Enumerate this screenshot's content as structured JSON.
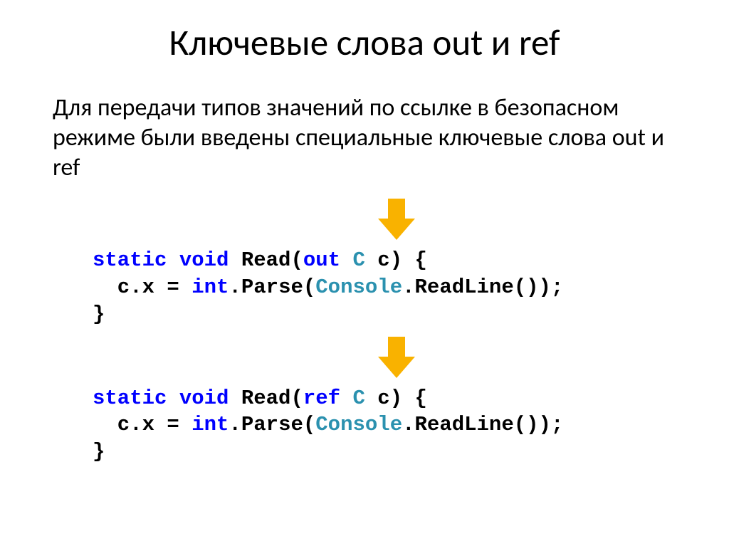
{
  "title": "Ключевые слова out и ref",
  "body": "Для передачи типов значений по ссылке в безопасном режиме были введены специальные ключевые слова out и ref",
  "arrow_color": "#f9b200",
  "code1": {
    "l1": {
      "a": "static void",
      "b": " Read(",
      "c": "out",
      "d": " ",
      "e": "C",
      "f": " c) {"
    },
    "l2": {
      "a": "  c.x = ",
      "b": "int",
      "c": ".Parse(",
      "d": "Console",
      "e": ".ReadLine());"
    },
    "l3": "}"
  },
  "code2": {
    "l1": {
      "a": "static void",
      "b": " Read(",
      "c": "ref",
      "d": " ",
      "e": "C",
      "f": " c) {"
    },
    "l2": {
      "a": "  c.x = ",
      "b": "int",
      "c": ".Parse(",
      "d": "Console",
      "e": ".ReadLine());"
    },
    "l3": "}"
  }
}
